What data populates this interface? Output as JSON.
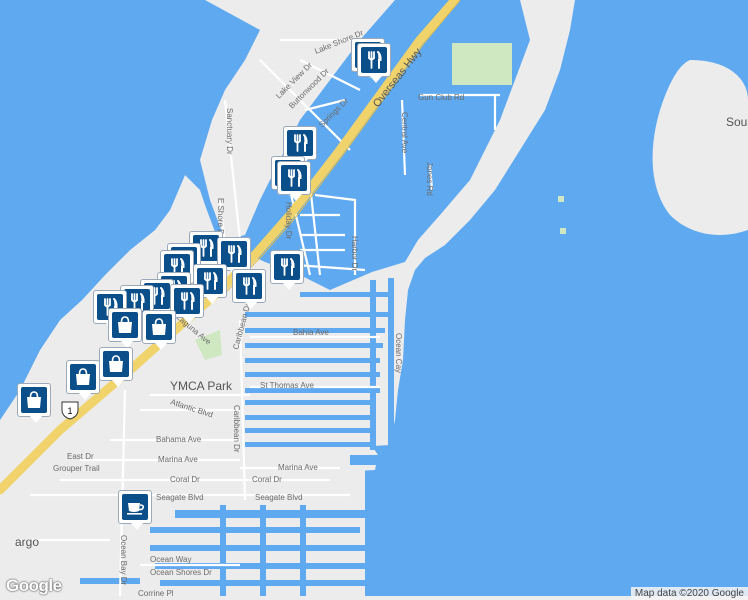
{
  "map": {
    "colors": {
      "water": "#5fa9f0",
      "land": "#ececec",
      "park": "#cfe8c2",
      "road": "#ffffff",
      "highway": "#f5dc7a",
      "marker": "#0a4f8a"
    },
    "labels": {
      "overseas_hwy": "Overseas Hwy",
      "lake_shore_dr": "Lake Shore Dr",
      "lake_view_dr": "Lake View Dr",
      "buttonwood_dr": "Buttonwood Dr",
      "springs_dr": "Springs Dr",
      "gun_club_rd": "Gun Club Rd",
      "central_ave": "Central Ave",
      "jones_rd": "Jones Rd",
      "sanctuary_dr": "Sanctuary Dr",
      "e_shore_dr": "E Shore Dr",
      "holiday_dr": "Holiday Dr",
      "harbor_dr": "Harbor Dr",
      "bahia_ave": "Bahia Ave",
      "ocean_cay": "Ocean Cay",
      "laguna_ave": "Laguna Ave",
      "caribbean_dr": "Caribbean Dr",
      "ymca_park": "YMCA Park",
      "st_thomas_ave": "St Thomas Ave",
      "atlantic_blvd": "Atlantic Blvd",
      "caribbean_dr_2": "Caribbean Dr",
      "bahama_ave": "Bahama Ave",
      "east_dr": "East Dr",
      "grouper_trail": "Grouper Trail",
      "marina_ave_1": "Marina Ave",
      "marina_ave_2": "Marina Ave",
      "coral_dr_1": "Coral Dr",
      "coral_dr_2": "Coral Dr",
      "seagate_blvd_1": "Seagate Blvd",
      "seagate_blvd_2": "Seagate Blvd",
      "ocean_bay_dr": "Ocean Bay Dr",
      "ocean_way": "Ocean Way",
      "ocean_shores_dr": "Ocean Shores Dr",
      "corrine_pl": "Corrine Pl",
      "largo": "argo",
      "sou": "Sou",
      "route_shield": "1"
    },
    "markers": [
      {
        "icon": "restaurant-icon"
      },
      {
        "icon": "restaurant-icon"
      },
      {
        "icon": "restaurant-icon"
      },
      {
        "icon": "restaurant-icon"
      },
      {
        "icon": "restaurant-icon"
      },
      {
        "icon": "restaurant-icon"
      },
      {
        "icon": "restaurant-icon"
      },
      {
        "icon": "restaurant-icon"
      },
      {
        "icon": "restaurant-icon"
      },
      {
        "icon": "restaurant-icon"
      },
      {
        "icon": "restaurant-icon"
      },
      {
        "icon": "restaurant-icon"
      },
      {
        "icon": "restaurant-icon"
      },
      {
        "icon": "restaurant-icon"
      },
      {
        "icon": "restaurant-icon"
      },
      {
        "icon": "restaurant-icon"
      },
      {
        "icon": "restaurant-icon"
      },
      {
        "icon": "shopping-bag-icon"
      },
      {
        "icon": "shopping-bag-icon"
      },
      {
        "icon": "shopping-bag-icon"
      },
      {
        "icon": "shopping-bag-icon"
      },
      {
        "icon": "shopping-bag-icon"
      },
      {
        "icon": "coffee-cup-icon"
      }
    ],
    "logo": "Google",
    "attribution": "Map data ©2020 Google"
  }
}
